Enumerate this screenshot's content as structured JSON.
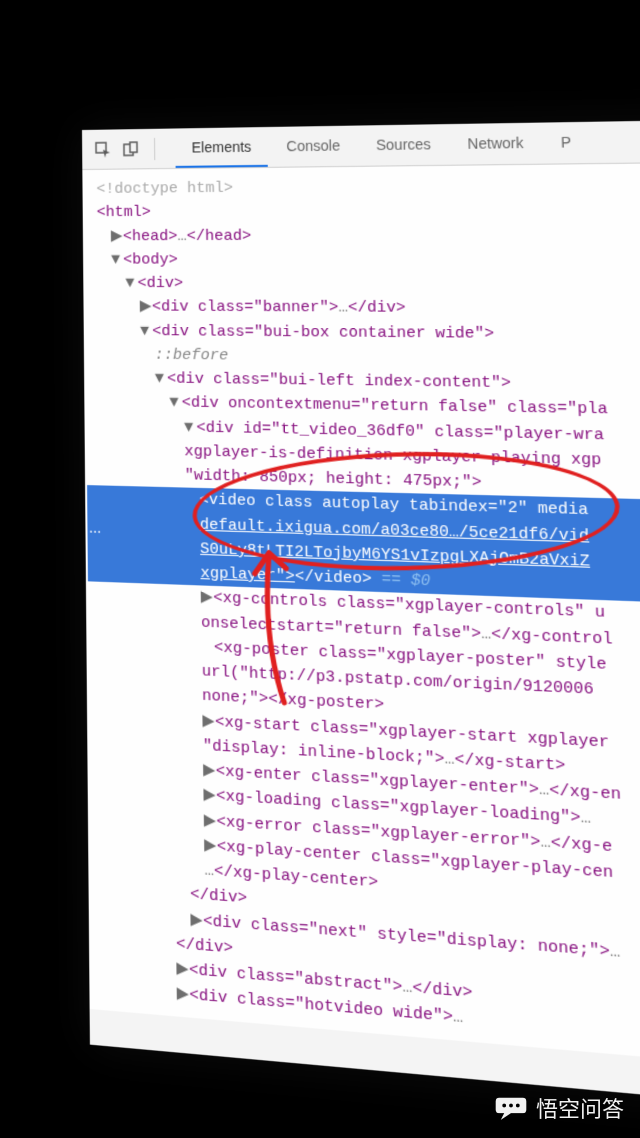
{
  "toolbar": {
    "inspect_icon": "inspect-element-icon",
    "device_icon": "device-toggle-icon"
  },
  "tabs": {
    "elements": "Elements",
    "console": "Console",
    "sources": "Sources",
    "network": "Network",
    "more": "P"
  },
  "dom": {
    "doctype": "<!doctype html>",
    "html_open": "<html>",
    "head": {
      "open": "<head>",
      "ellipsis": "…",
      "close": "</head>"
    },
    "body_open": "<body>",
    "div_open": "<div>",
    "banner": {
      "open": "<div class=\"banner\">",
      "ellipsis": "…",
      "close": "</div>"
    },
    "bui_box": "<div class=\"bui-box container wide\">",
    "before": "::before",
    "bui_left": "<div class=\"bui-left index-content\">",
    "oncontext": "<div oncontextmenu=\"return false\" class=\"pla",
    "tt_video_l1": "<div id=\"tt_video_36df0\" class=\"player-wra",
    "tt_video_l2": "xgplayer-is-definition xgplayer-playing xgp",
    "tt_video_l3": "\"width: 850px; height: 475px;\">",
    "video_l1": "<video class autoplay tabindex=\"2\" media",
    "video_l2": "default.ixigua.com/a03ce80…/5ce21df6/vid",
    "video_l3": "S0uLy8tLTI2LTojbyM6YS1vIzpgLXAjOmB2aVxiZ",
    "video_l4_a": "xgplayer\">",
    "video_l4_b": "</video>",
    "video_eqsel": " == $0",
    "xg_controls_l1": "<xg-controls class=\"xgplayer-controls\" u",
    "xg_controls_l2": "onselectstart=\"return false\">",
    "xg_controls_l2b": "</xg-control",
    "xg_poster_l1": "<xg-poster class=\"xgplayer-poster\" style",
    "xg_poster_l2": "url(\"http://p3.pstatp.com/origin/9120006",
    "xg_poster_l3": "none;\"></xg-poster>",
    "xg_start_l1": "<xg-start class=\"xgplayer-start xgplayer",
    "xg_start_l2": "\"display: inline-block;\">",
    "xg_start_l2b": "</xg-start>",
    "xg_enter": "<xg-enter class=\"xgplayer-enter\">",
    "xg_enter_b": "</xg-en",
    "xg_loading": "<xg-loading class=\"xgplayer-loading\">",
    "xg_error": "<xg-error class=\"xgplayer-error\">",
    "xg_error_b": "</xg-e",
    "xg_playcenter_l1": "<xg-play-center class=\"xgplayer-play-cen",
    "xg_playcenter_l2": "</xg-play-center>",
    "div_close": "</div>",
    "next": "<div class=\"next\" style=\"display: none;\">",
    "abstract": {
      "open": "<div class=\"abstract\">",
      "close": "</div>"
    },
    "hotvideo": "<div class=\"hotvideo wide\">"
  },
  "watermark": {
    "text": "悟空问答"
  }
}
